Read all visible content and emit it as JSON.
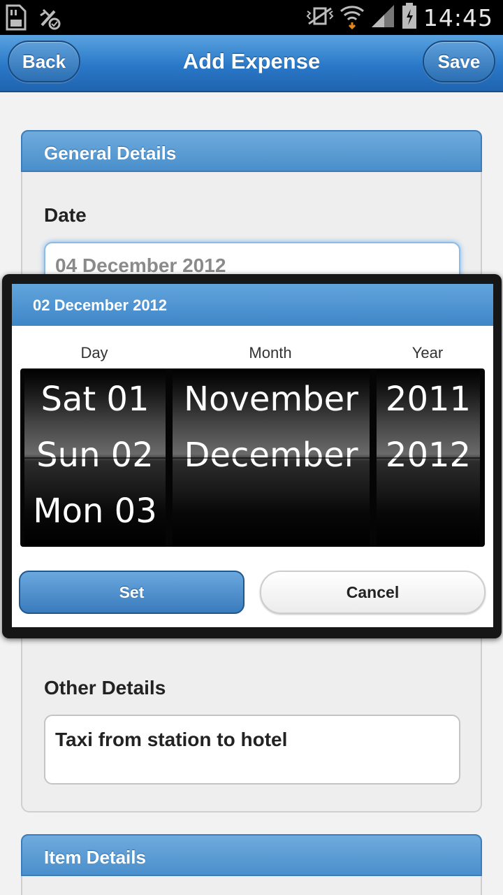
{
  "status_bar": {
    "time": "14:45",
    "icons": [
      "sd-card-icon",
      "usb-debug-icon",
      "vibrate-icon",
      "wifi-icon",
      "signal-icon",
      "battery-charging-icon"
    ]
  },
  "header": {
    "back_label": "Back",
    "title": "Add Expense",
    "save_label": "Save"
  },
  "general_details": {
    "heading": "General Details",
    "date_label": "Date",
    "date_value": "04 December 2012",
    "other_label": "Other Details",
    "other_value": "Taxi from station to hotel"
  },
  "item_details": {
    "heading": "Item Details"
  },
  "date_picker": {
    "heading": "02 December 2012",
    "day_label": "Day",
    "month_label": "Month",
    "year_label": "Year",
    "day_items": [
      "Sat 01",
      "Sun 02",
      "Mon 03"
    ],
    "month_items": [
      "November",
      "December"
    ],
    "year_items": [
      "2011",
      "2012"
    ],
    "set_label": "Set",
    "cancel_label": "Cancel"
  },
  "colors": {
    "header_blue": "#2a78c8",
    "panel_head_blue": "#4a8fcb",
    "picker_bg": "#050505"
  }
}
